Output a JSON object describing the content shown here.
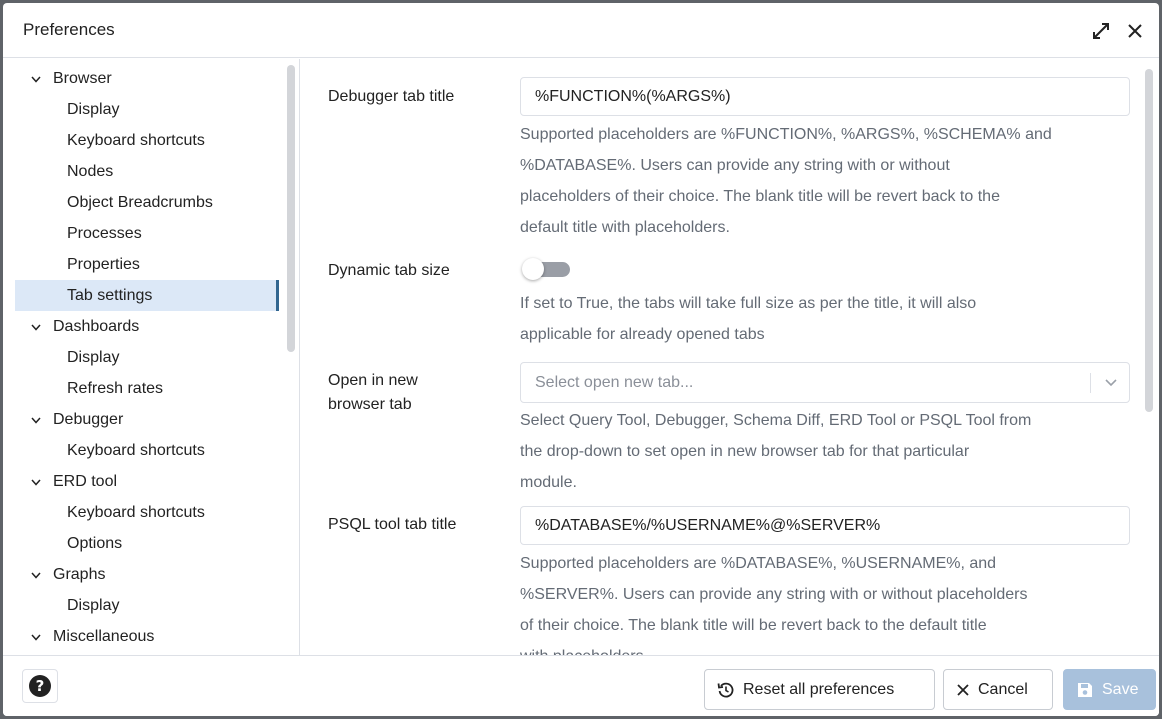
{
  "dialog": {
    "title": "Preferences"
  },
  "sidebar": {
    "tree": [
      {
        "type": "group",
        "label": "Browser"
      },
      {
        "type": "child",
        "label": "Display"
      },
      {
        "type": "child",
        "label": "Keyboard shortcuts"
      },
      {
        "type": "child",
        "label": "Nodes"
      },
      {
        "type": "child",
        "label": "Object Breadcrumbs"
      },
      {
        "type": "child",
        "label": "Processes"
      },
      {
        "type": "child",
        "label": "Properties"
      },
      {
        "type": "child",
        "label": "Tab settings",
        "selected": true
      },
      {
        "type": "group",
        "label": "Dashboards"
      },
      {
        "type": "child",
        "label": "Display"
      },
      {
        "type": "child",
        "label": "Refresh rates"
      },
      {
        "type": "group",
        "label": "Debugger"
      },
      {
        "type": "child",
        "label": "Keyboard shortcuts"
      },
      {
        "type": "group",
        "label": "ERD tool"
      },
      {
        "type": "child",
        "label": "Keyboard shortcuts"
      },
      {
        "type": "child",
        "label": "Options"
      },
      {
        "type": "group",
        "label": "Graphs"
      },
      {
        "type": "child",
        "label": "Display"
      },
      {
        "type": "group",
        "label": "Miscellaneous"
      }
    ]
  },
  "settings": {
    "debugger_tab_title": {
      "label": "Debugger tab title",
      "value": "%FUNCTION%(%ARGS%)",
      "help": [
        "Supported placeholders are %FUNCTION%, %ARGS%, %SCHEMA% and",
        "%DATABASE%. Users can provide any string with or without",
        "placeholders of their choice. The blank title will be revert back to the",
        "default title with placeholders."
      ]
    },
    "dynamic_tab_size": {
      "label": "Dynamic tab size",
      "checked": false,
      "help": [
        "If set to True, the tabs will take full size as per the title, it will also",
        "applicable for already opened tabs"
      ]
    },
    "open_in_new_tab": {
      "label_line1": "Open in new",
      "label_line2": "browser tab",
      "placeholder": "Select open new tab...",
      "help": [
        "Select Query Tool, Debugger, Schema Diff, ERD Tool or PSQL Tool from",
        "the drop-down to set open in new browser tab for that particular",
        "module."
      ]
    },
    "psql_tab_title": {
      "label": "PSQL tool tab title",
      "value": "%DATABASE%/%USERNAME%@%SERVER%",
      "help": [
        "Supported placeholders are %DATABASE%, %USERNAME%, and",
        "%SERVER%. Users can provide any string with or without placeholders",
        "of their choice. The blank title will be revert back to the default title",
        "with placeholders."
      ]
    }
  },
  "footer": {
    "reset_label": "Reset all preferences",
    "cancel_label": "Cancel",
    "save_label": "Save"
  },
  "colors": {
    "accent": "#326690",
    "selected_bg": "#dce8f7",
    "save_disabled": "#a8c1dc"
  }
}
